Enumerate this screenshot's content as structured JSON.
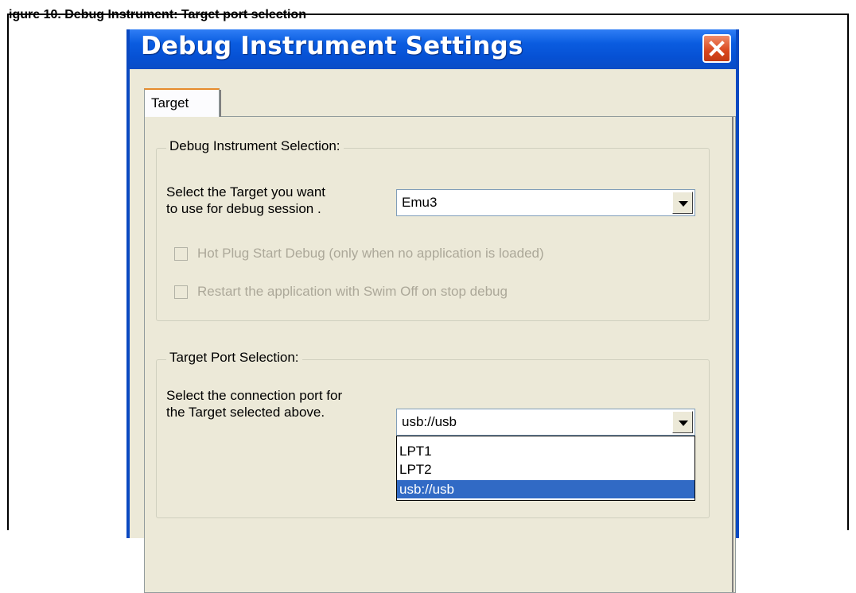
{
  "figure_caption": "igure 10. Debug Instrument: Target port selection",
  "window": {
    "title": "Debug Instrument Settings",
    "close_icon": "close-icon"
  },
  "tabs": [
    {
      "label": "Target",
      "active": true
    }
  ],
  "debug_group": {
    "legend": "Debug Instrument Selection:",
    "prompt_line1": "Select the Target you want",
    "prompt_line2": "to use for debug session .",
    "target_value": "Emu3",
    "hot_plug_label": "Hot Plug Start Debug (only when no application is loaded)",
    "hot_plug_checked": false,
    "restart_label": "Restart the application with Swim Off on stop debug",
    "restart_checked": false
  },
  "port_group": {
    "legend": "Target Port Selection:",
    "prompt_line1": "Select the connection port for",
    "prompt_line2": "the Target selected above.",
    "port_value": "usb://usb",
    "options": [
      "LPT1",
      "LPT2",
      "usb://usb"
    ],
    "selected_option": "usb://usb"
  },
  "colors": {
    "title_bar": "#0a5ce0",
    "dialog_bg": "#ece9d8",
    "selection": "#316ac5",
    "close_button": "#d9461d",
    "tab_highlight": "#e68b2c"
  }
}
